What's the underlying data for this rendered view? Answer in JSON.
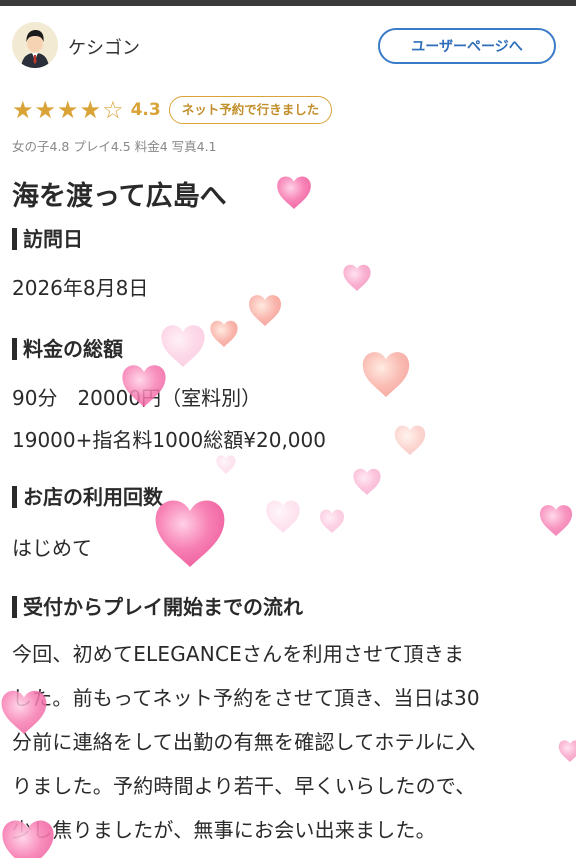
{
  "user": {
    "name": "ケシゴン",
    "page_button": "ユーザーページへ"
  },
  "rating": {
    "stars_filled": 4,
    "stars_total": 5,
    "score": "4.3",
    "badge": "ネット予約で行きました",
    "subscores": "女の子4.8 プレイ4.5 料金4 写真4.1"
  },
  "review": {
    "title": "海を渡って広島へ",
    "sections": {
      "visit_date": {
        "heading": "訪問日",
        "value": "2026年8月8日"
      },
      "price": {
        "heading": "料金の総額",
        "line1": "90分　20000円（室料別）",
        "line2": "19000+指名料1000総額¥20,000"
      },
      "visits": {
        "heading": "お店の利用回数",
        "value": "はじめて"
      },
      "flow": {
        "heading": "受付からプレイ開始までの流れ",
        "lines": [
          "今回、初めてELEGANCEさんを利用させて頂きま",
          "した。前もってネット予約をさせて頂き、当日は30",
          "分前に連絡をして出勤の有無を確認してホテルに入",
          "りました。予約時間より若干、早くいらしたので、",
          "少し焦りましたが、無事にお会い出来ました。"
        ]
      }
    }
  },
  "colors": {
    "star": "#d9a338",
    "button_border": "#3a7bc8",
    "heart_pink": "#f77fb3"
  }
}
